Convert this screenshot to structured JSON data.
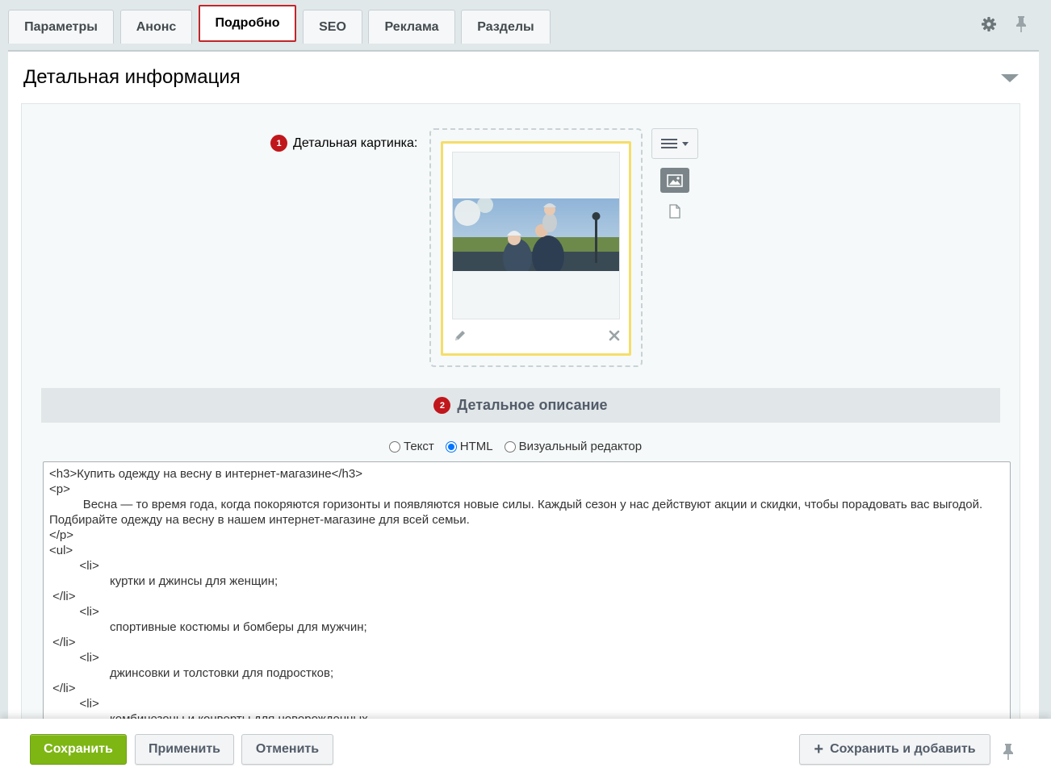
{
  "tabs": [
    {
      "label": "Параметры"
    },
    {
      "label": "Анонс"
    },
    {
      "label": "Подробно"
    },
    {
      "label": "SEO"
    },
    {
      "label": "Реклама"
    },
    {
      "label": "Разделы"
    }
  ],
  "active_tab": "Подробно",
  "section": {
    "title": "Детальная информация"
  },
  "picture": {
    "badge": "1",
    "label": "Детальная картинка:"
  },
  "description": {
    "badge": "2",
    "title": "Детальное описание",
    "modes": [
      {
        "label": "Текст",
        "selected": false
      },
      {
        "label": "HTML",
        "selected": true
      },
      {
        "label": "Визуальный редактор",
        "selected": false
      }
    ],
    "content": "<h3>Купить одежду на весну в интернет-магазине</h3>\n<p>\n          Весна — то время года, когда покоряются горизонты и появляются новые силы. Каждый сезон у нас действуют акции и скидки, чтобы порадовать вас выгодой. Подбирайте одежду на весну в нашем интернет-магазине для всей семьи.\n</p>\n<ul>\n         <li>\n                  куртки и джинсы для женщин;\n </li>\n         <li>\n                  спортивные костюмы и бомберы для мужчин;\n </li>\n         <li>\n                  джинсовки и толстовки для подростков;\n </li>\n         <li>\n                  комбинезоны и конверты для новорожденных."
  },
  "actions": {
    "save": "Сохранить",
    "apply": "Применить",
    "cancel": "Отменить",
    "save_add": "Сохранить и добавить"
  },
  "icons": {
    "settings": "gear-icon",
    "pin": "pin-icon",
    "collapse": "triangle-down-icon",
    "menu": "hamburger-menu-icon",
    "image": "image-icon",
    "file": "file-icon",
    "edit": "pencil-icon",
    "delete": "close-icon"
  },
  "colors": {
    "accent": "#c0262b",
    "badge": "#c0171c",
    "save_button": "#7eb614",
    "picture_highlight": "#f5de6a"
  }
}
